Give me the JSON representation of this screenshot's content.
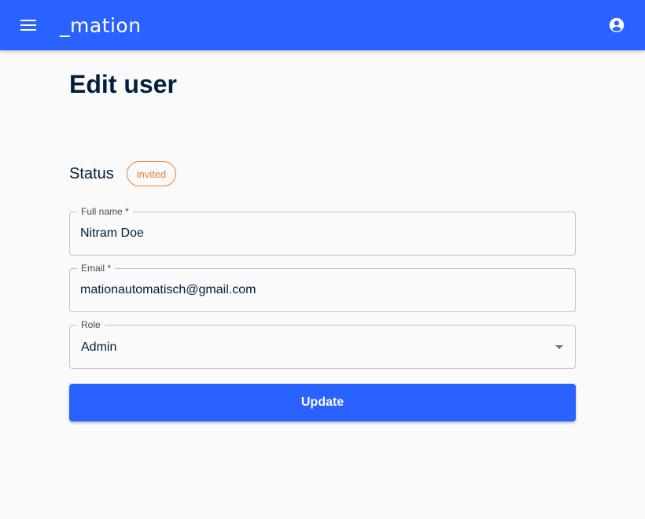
{
  "app": {
    "logo_text": "_mation",
    "brand_color": "#2962ff"
  },
  "icons": {
    "menu": "menu-icon",
    "account": "account-circle-icon",
    "dropdown": "arrow-drop-down-icon"
  },
  "page": {
    "title": "Edit user"
  },
  "status": {
    "label": "Status",
    "badge": "invited",
    "badge_color": "#e8803a"
  },
  "form": {
    "full_name": {
      "label": "Full name *",
      "value": "Nitram Doe"
    },
    "email": {
      "label": "Email *",
      "value": "mationautomatisch@gmail.com"
    },
    "role": {
      "label": "Role",
      "value": "Admin"
    },
    "submit_label": "Update"
  }
}
